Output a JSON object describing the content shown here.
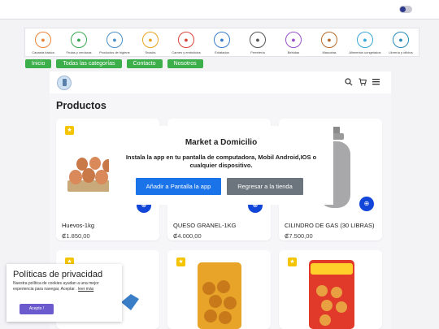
{
  "categories": [
    {
      "label": "Canasta básica",
      "icon": "basket-icon",
      "color": "#e8833a"
    },
    {
      "label": "Frutas y verduras",
      "icon": "apple-icon",
      "color": "#3aa84f"
    },
    {
      "label": "Productos de higiene",
      "icon": "soap-bottle-icon",
      "color": "#4a90c8"
    },
    {
      "label": "Snacks",
      "icon": "snack-bag-icon",
      "color": "#e8a420"
    },
    {
      "label": "Carnes y embutidos",
      "icon": "meat-icon",
      "color": "#d8453a"
    },
    {
      "label": "Enlatados",
      "icon": "can-icon",
      "color": "#3a7ec8"
    },
    {
      "label": "Ferretería",
      "icon": "wrench-icon",
      "color": "#555555"
    },
    {
      "label": "Bebidas",
      "icon": "bottle-icon",
      "color": "#9b4fc8"
    },
    {
      "label": "Mascotas",
      "icon": "paw-icon",
      "color": "#b86a2a"
    },
    {
      "label": "Alimentos congelados",
      "icon": "snowflake-icon",
      "color": "#3aa8d8"
    },
    {
      "label": "Librería y oficina",
      "icon": "book-icon",
      "color": "#2a8ab8"
    }
  ],
  "nav": [
    "Inicio",
    "Todas las categorías",
    "Contacto",
    "Nosotros"
  ],
  "header": {
    "search_icon": "search-icon",
    "cart_icon": "cart-icon",
    "menu_icon": "hamburger-menu-icon"
  },
  "products_title": "Productos",
  "products": [
    {
      "name": "Huevos-1kg",
      "price": "₡1.850,00"
    },
    {
      "name": "QUESO GRANEL-1KG",
      "price": "₡4.000,00"
    },
    {
      "name": "CILINDRO DE GAS (30 LIBRAS)",
      "price": "₡7.500,00"
    }
  ],
  "modal": {
    "title": "Market a Domicilio",
    "text": "Instala la app en tu pantalla de computadora, Mobil Android,IOS o cualquier dispositivo.",
    "primary_label": "Añadir a Pantalla la app",
    "secondary_label": "Regresar a la tienda"
  },
  "privacy": {
    "title": "Políticas de privacidad",
    "text": "Nuestra política de cookies ayudan a una mejor experiencia para navegar, Aceptar .",
    "link": "leer más",
    "accept_label": "Acepto !"
  },
  "colors": {
    "nav_green": "#3cae4a",
    "primary_blue": "#1a73e8",
    "cart_blue": "#1246d8",
    "star_yellow": "#f5c400"
  }
}
